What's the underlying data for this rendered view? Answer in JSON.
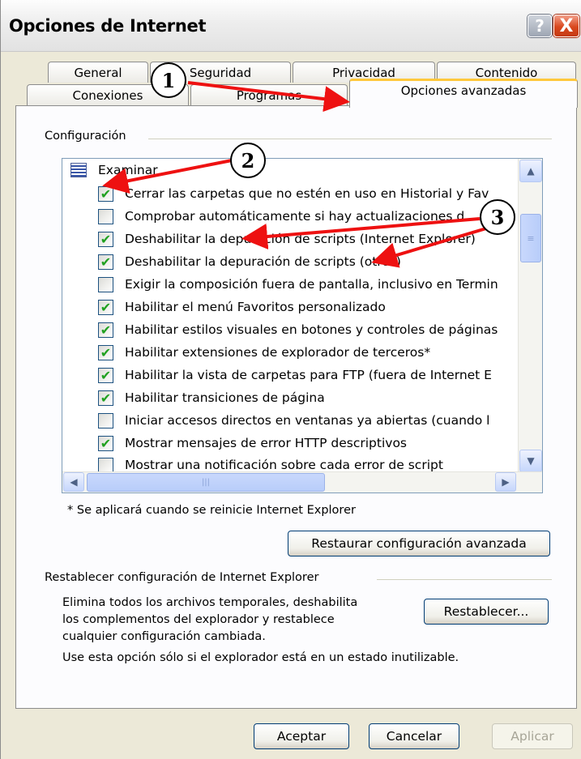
{
  "window": {
    "title": "Opciones de Internet",
    "help_button": "?",
    "close_button": "X"
  },
  "tabs": {
    "row1": [
      "General",
      "Seguridad",
      "Privacidad",
      "Contenido"
    ],
    "row2": [
      "Conexiones",
      "Programas",
      "Opciones avanzadas"
    ],
    "active": "Opciones avanzadas"
  },
  "settings": {
    "group_label": "Configuración",
    "root_label": "Examinar",
    "items": [
      {
        "label": "Cerrar las carpetas que no estén en uso en Historial y Fav",
        "checked": true
      },
      {
        "label": "Comprobar automáticamente si hay actualizaciones d",
        "checked": false
      },
      {
        "label": "Deshabilitar la depuración de scripts (Internet Explorer)",
        "checked": true
      },
      {
        "label": "Deshabilitar la depuración de scripts (otros)",
        "checked": true
      },
      {
        "label": "Exigir la composición fuera de pantalla, inclusivo en Termin",
        "checked": false
      },
      {
        "label": "Habilitar el menú Favoritos personalizado",
        "checked": true
      },
      {
        "label": "Habilitar estilos visuales en botones y controles de páginas",
        "checked": true
      },
      {
        "label": "Habilitar extensiones de explorador de terceros*",
        "checked": true
      },
      {
        "label": "Habilitar la vista de carpetas para FTP (fuera de Internet E",
        "checked": true
      },
      {
        "label": "Habilitar transiciones de página",
        "checked": true
      },
      {
        "label": "Iniciar accesos directos en ventanas ya abiertas (cuando l",
        "checked": false
      },
      {
        "label": "Mostrar mensajes de error HTTP descriptivos",
        "checked": true
      },
      {
        "label": "Mostrar una notificación sobre cada error de script",
        "checked": false
      }
    ],
    "check_glyph": "✔",
    "footnote": "* Se aplicará cuando se reinicie Internet Explorer",
    "restore_button": "Restaurar configuración avanzada"
  },
  "reset": {
    "group_label": "Restablecer configuración de Internet Explorer",
    "description_lines": [
      "Elimina todos los archivos temporales, deshabilita",
      "los complementos del explorador y restablece",
      "cualquier configuración cambiada."
    ],
    "note": "Use esta opción sólo si el explorador está en un estado inutilizable.",
    "reset_button": "Restablecer..."
  },
  "footer": {
    "ok_button": "Aceptar",
    "cancel_button": "Cancelar",
    "apply_button": "Aplicar",
    "apply_enabled": false
  },
  "callouts": [
    "1",
    "2",
    "3"
  ],
  "colors": {
    "callout_arrow": "#ee1111",
    "checkmark": "#21a121",
    "active_tab_highlight": "#ffc83c"
  }
}
